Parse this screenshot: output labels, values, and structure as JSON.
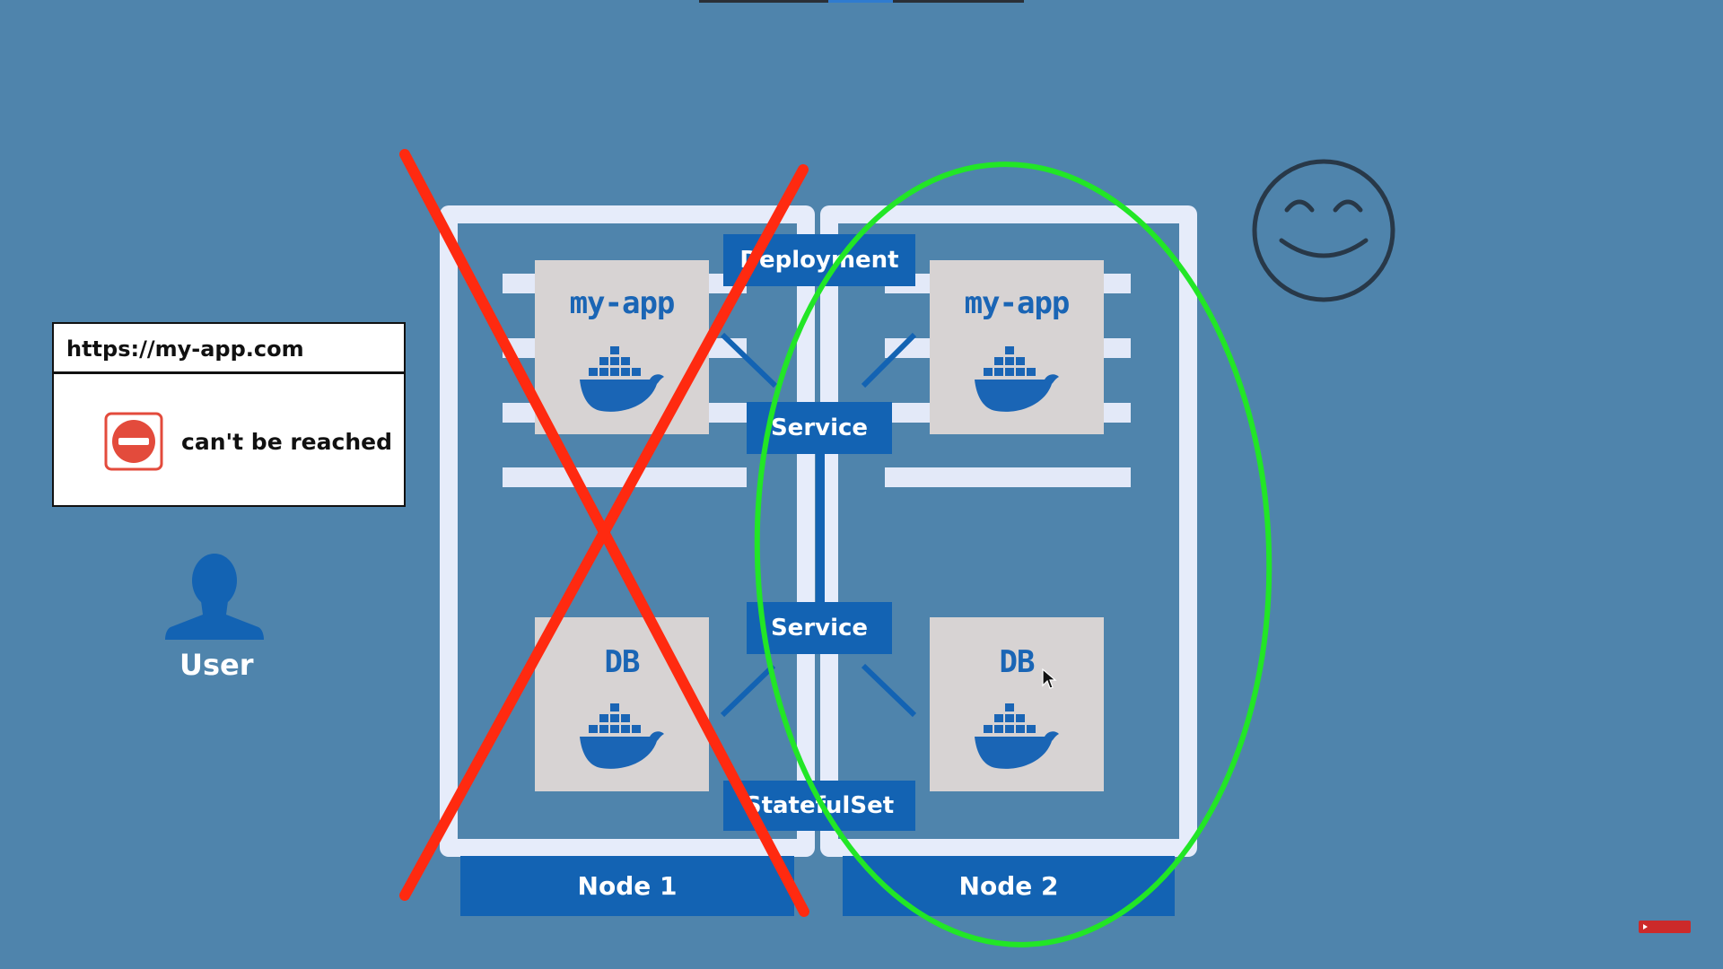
{
  "browser": {
    "url": "https://my-app.com",
    "error_text": "can't be reached",
    "icon": "no-entry-icon"
  },
  "user": {
    "label": "User",
    "icon": "user-icon"
  },
  "nodes": [
    {
      "label": "Node 1",
      "app_label": "my-app",
      "db_label": "DB",
      "status": "crossed-out"
    },
    {
      "label": "Node 2",
      "app_label": "my-app",
      "db_label": "DB",
      "status": "circled"
    }
  ],
  "labels": {
    "deployment": "Deployment",
    "service_app": "Service",
    "service_db": "Service",
    "statefulset": "StatefulSet"
  },
  "icons": [
    "docker-icon",
    "smiley-face-icon",
    "mouse-cursor-icon",
    "red-x-mark",
    "green-ellipse"
  ],
  "colors": {
    "background": "#4f84ac",
    "label_blue": "#1363b3",
    "x_mark": "#ff2a10",
    "ellipse": "#22e626",
    "error_red": "#e34b3c"
  }
}
